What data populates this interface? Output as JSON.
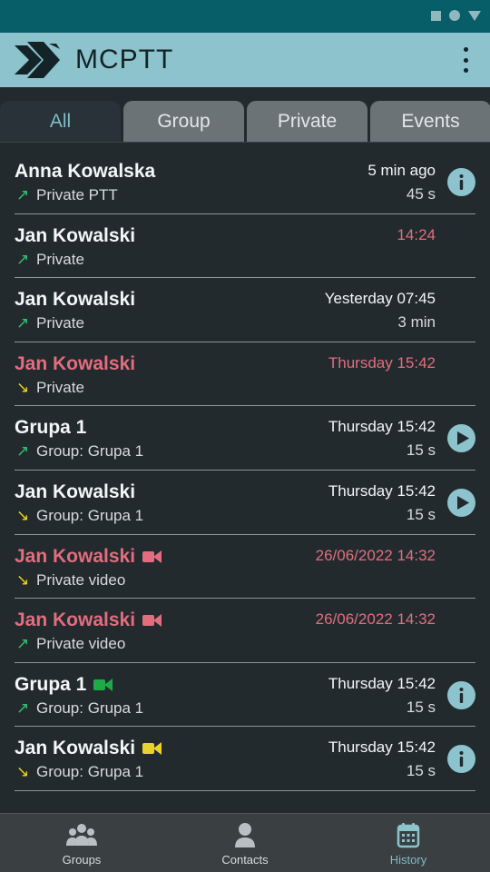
{
  "app": {
    "title": "MCPTT"
  },
  "tabs": [
    {
      "label": "All",
      "active": true
    },
    {
      "label": "Group",
      "active": false
    },
    {
      "label": "Private",
      "active": false
    },
    {
      "label": "Events",
      "active": false
    }
  ],
  "history": [
    {
      "name": "Anna Kowalska",
      "direction": "outgoing",
      "type": "Private PTT",
      "time": "5 min ago",
      "duration": "45 s",
      "missed": false,
      "action": "info-icon"
    },
    {
      "name": "Jan Kowalski",
      "direction": "outgoing",
      "type": "Private",
      "time": "14:24",
      "duration": "",
      "missed": false,
      "time_red": true,
      "action": ""
    },
    {
      "name": "Jan Kowalski",
      "direction": "outgoing",
      "type": "Private",
      "time": "Yesterday 07:45",
      "duration": "3 min",
      "missed": false,
      "action": ""
    },
    {
      "name": "Jan Kowalski",
      "direction": "incoming",
      "type": "Private",
      "time": "Thursday 15:42",
      "duration": "",
      "missed": true,
      "action": ""
    },
    {
      "name": "Grupa 1",
      "direction": "outgoing",
      "type": "Group: Grupa 1",
      "time": "Thursday 15:42",
      "duration": "15 s",
      "missed": false,
      "action": "play-icon"
    },
    {
      "name": "Jan Kowalski",
      "direction": "incoming",
      "type": "Group: Grupa 1",
      "time": "Thursday 15:42",
      "duration": "15 s",
      "missed": false,
      "action": "play-icon"
    },
    {
      "name": "Jan Kowalski",
      "direction": "incoming",
      "type": "Private video",
      "time": "26/06/2022 14:32",
      "duration": "",
      "missed": true,
      "video_color": "#e36d7e",
      "action": ""
    },
    {
      "name": "Jan Kowalski",
      "direction": "outgoing",
      "type": "Private video",
      "time": "26/06/2022 14:32",
      "duration": "",
      "missed": true,
      "video_color": "#e36d7e",
      "action": ""
    },
    {
      "name": "Grupa 1",
      "direction": "outgoing",
      "type": "Group: Grupa 1",
      "time": "Thursday 15:42",
      "duration": "15 s",
      "missed": false,
      "video_color": "#1faa4a",
      "action": "info-icon"
    },
    {
      "name": "Jan Kowalski",
      "direction": "incoming",
      "type": "Group: Grupa 1",
      "time": "Thursday 15:42",
      "duration": "15 s",
      "missed": false,
      "video_color": "#e9d32a",
      "action": "info-icon"
    }
  ],
  "bottom_nav": [
    {
      "label": "Groups",
      "icon": "groups-icon",
      "active": false
    },
    {
      "label": "Contacts",
      "icon": "contacts-icon",
      "active": false
    },
    {
      "label": "History",
      "icon": "calendar-icon",
      "active": true
    }
  ],
  "colors": {
    "accent": "#8cc3cc",
    "status_bar": "#075d68",
    "missed": "#e36d7e",
    "outgoing_arrow": "#33c26b",
    "incoming_arrow": "#f1d61b"
  }
}
